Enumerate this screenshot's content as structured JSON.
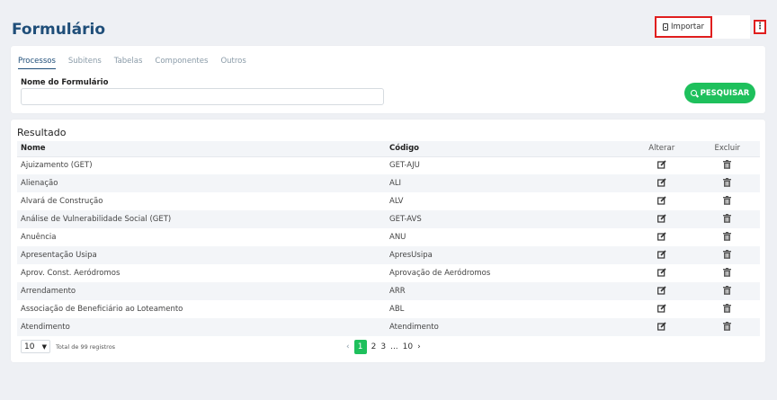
{
  "header": {
    "title": "Formulário",
    "import_label": "Importar",
    "more_label": "⋮"
  },
  "search": {
    "tabs": [
      {
        "label": "Processos",
        "active": true
      },
      {
        "label": "Subitens",
        "active": false
      },
      {
        "label": "Tabelas",
        "active": false
      },
      {
        "label": "Componentes",
        "active": false
      },
      {
        "label": "Outros",
        "active": false
      }
    ],
    "field_label": "Nome do Formulário",
    "field_value": "",
    "button_label": "PESQUISAR"
  },
  "result": {
    "title": "Resultado",
    "columns": {
      "name": "Nome",
      "code": "Código",
      "edit": "Alterar",
      "delete": "Excluir"
    },
    "rows": [
      {
        "name": "Ajuizamento (GET)",
        "code": "GET-AJU"
      },
      {
        "name": "Alienação",
        "code": "ALI"
      },
      {
        "name": "Alvará de Construção",
        "code": "ALV"
      },
      {
        "name": "Análise de Vulnerabilidade Social (GET)",
        "code": "GET-AVS"
      },
      {
        "name": "Anuência",
        "code": "ANU"
      },
      {
        "name": "Apresentação Usipa",
        "code": "ApresUsipa"
      },
      {
        "name": "Aprov. Const. Aeródromos",
        "code": "Aprovação de Aeródromos"
      },
      {
        "name": "Arrendamento",
        "code": "ARR"
      },
      {
        "name": "Associação de Beneficiário ao Loteamento",
        "code": "ABL"
      },
      {
        "name": "Atendimento",
        "code": "Atendimento"
      }
    ],
    "page_size": "10",
    "total_text": "Total de 99 registros",
    "pagination": {
      "prev": "‹",
      "pages": [
        "1",
        "2",
        "3",
        "...",
        "10"
      ],
      "current": "1",
      "next": "›"
    }
  },
  "colors": {
    "accent": "#1ec05c",
    "title": "#1f4e79",
    "highlight": "#e01e1e"
  }
}
